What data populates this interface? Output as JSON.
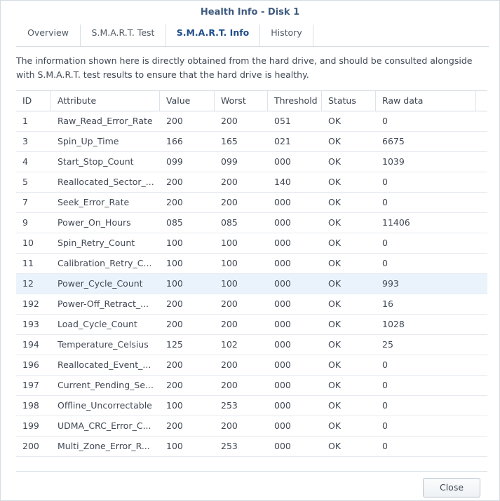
{
  "window": {
    "title": "Health Info - Disk 1"
  },
  "tabs": [
    {
      "label": "Overview",
      "active": false
    },
    {
      "label": "S.M.A.R.T. Test",
      "active": false
    },
    {
      "label": "S.M.A.R.T. Info",
      "active": true
    },
    {
      "label": "History",
      "active": false
    }
  ],
  "description": "The information shown here is directly obtained from the hard drive, and should be consulted alongside with S.M.A.R.T. test results to ensure that the hard drive is healthy.",
  "table": {
    "columns": [
      "ID",
      "Attribute",
      "Value",
      "Worst",
      "Threshold",
      "Status",
      "Raw data"
    ],
    "selected_id": "12",
    "rows": [
      [
        "1",
        "Raw_Read_Error_Rate",
        "200",
        "200",
        "051",
        "OK",
        "0"
      ],
      [
        "3",
        "Spin_Up_Time",
        "166",
        "165",
        "021",
        "OK",
        "6675"
      ],
      [
        "4",
        "Start_Stop_Count",
        "099",
        "099",
        "000",
        "OK",
        "1039"
      ],
      [
        "5",
        "Reallocated_Sector_...",
        "200",
        "200",
        "140",
        "OK",
        "0"
      ],
      [
        "7",
        "Seek_Error_Rate",
        "200",
        "200",
        "000",
        "OK",
        "0"
      ],
      [
        "9",
        "Power_On_Hours",
        "085",
        "085",
        "000",
        "OK",
        "11406"
      ],
      [
        "10",
        "Spin_Retry_Count",
        "100",
        "100",
        "000",
        "OK",
        "0"
      ],
      [
        "11",
        "Calibration_Retry_C...",
        "100",
        "100",
        "000",
        "OK",
        "0"
      ],
      [
        "12",
        "Power_Cycle_Count",
        "100",
        "100",
        "000",
        "OK",
        "993"
      ],
      [
        "192",
        "Power-Off_Retract_...",
        "200",
        "200",
        "000",
        "OK",
        "16"
      ],
      [
        "193",
        "Load_Cycle_Count",
        "200",
        "200",
        "000",
        "OK",
        "1028"
      ],
      [
        "194",
        "Temperature_Celsius",
        "125",
        "102",
        "000",
        "OK",
        "25"
      ],
      [
        "196",
        "Reallocated_Event_...",
        "200",
        "200",
        "000",
        "OK",
        "0"
      ],
      [
        "197",
        "Current_Pending_Se...",
        "200",
        "200",
        "000",
        "OK",
        "0"
      ],
      [
        "198",
        "Offline_Uncorrectable",
        "100",
        "253",
        "000",
        "OK",
        "0"
      ],
      [
        "199",
        "UDMA_CRC_Error_C...",
        "200",
        "200",
        "000",
        "OK",
        "0"
      ],
      [
        "200",
        "Multi_Zone_Error_R...",
        "100",
        "253",
        "000",
        "OK",
        "0"
      ]
    ]
  },
  "footer": {
    "close_label": "Close"
  }
}
